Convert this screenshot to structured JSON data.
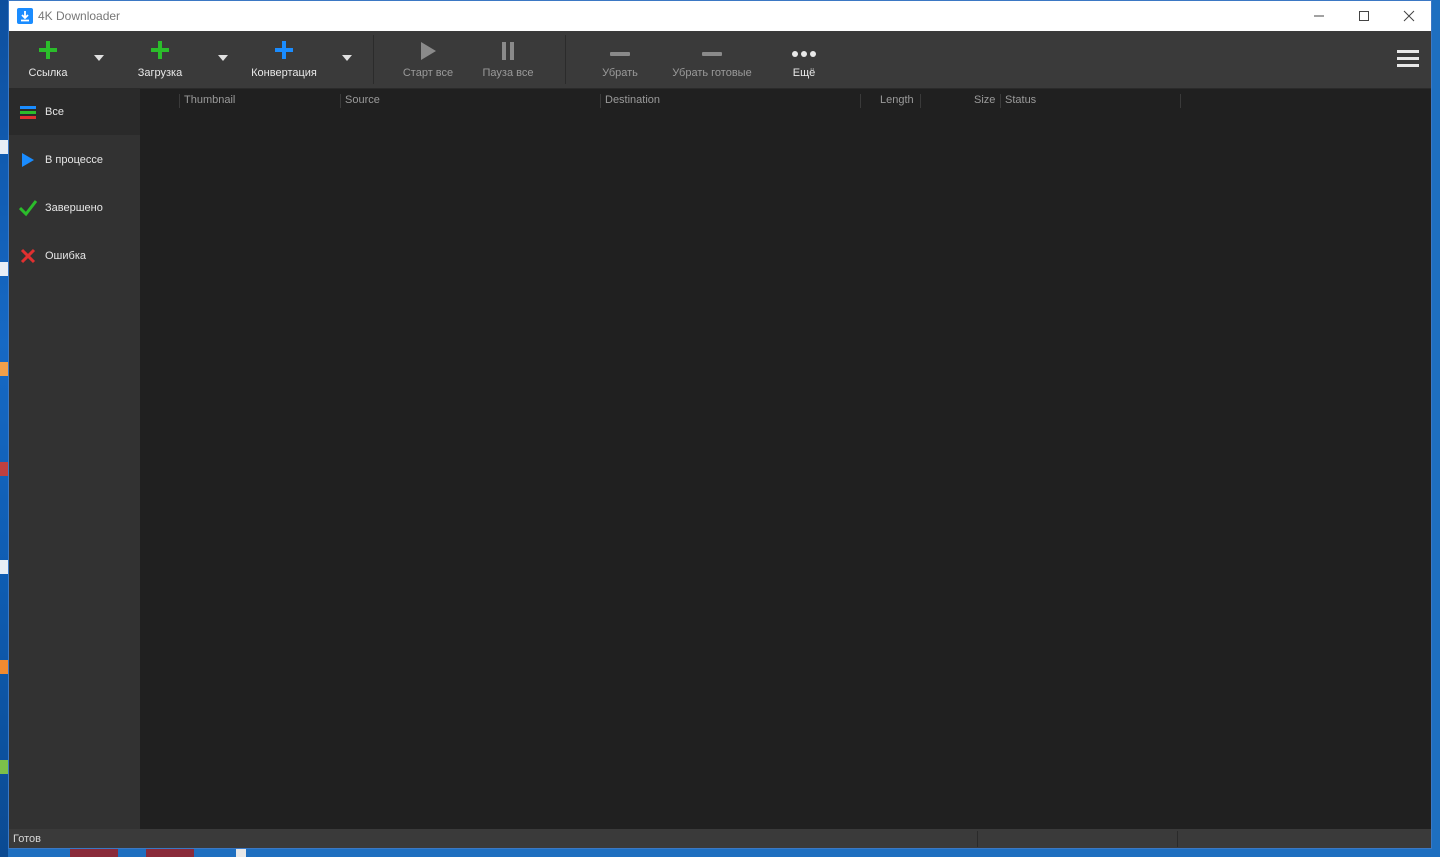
{
  "window": {
    "title": "4K Downloader"
  },
  "toolbar": {
    "link_label": "Ссылка",
    "download_label": "Загрузка",
    "convert_label": "Конвертация",
    "start_all_label": "Старт все",
    "pause_all_label": "Пауза все",
    "remove_label": "Убрать",
    "remove_done_label": "Убрать готовые",
    "more_label": "Ещё"
  },
  "sidebar": {
    "items": [
      {
        "label": "Все",
        "icon": "list-icon"
      },
      {
        "label": "В процессе",
        "icon": "play-icon"
      },
      {
        "label": "Завершено",
        "icon": "check-icon"
      },
      {
        "label": "Ошибка",
        "icon": "error-x-icon"
      }
    ]
  },
  "table": {
    "columns": [
      "Thumbnail",
      "Source",
      "Destination",
      "Length",
      "Size",
      "Status"
    ]
  },
  "status": {
    "text": "Готов"
  },
  "colors": {
    "accent_green": "#2bbd2b",
    "accent_blue": "#1a8cff",
    "error_red": "#e03030",
    "toolbar_bg": "#3a3a3a",
    "content_bg": "#202020"
  }
}
